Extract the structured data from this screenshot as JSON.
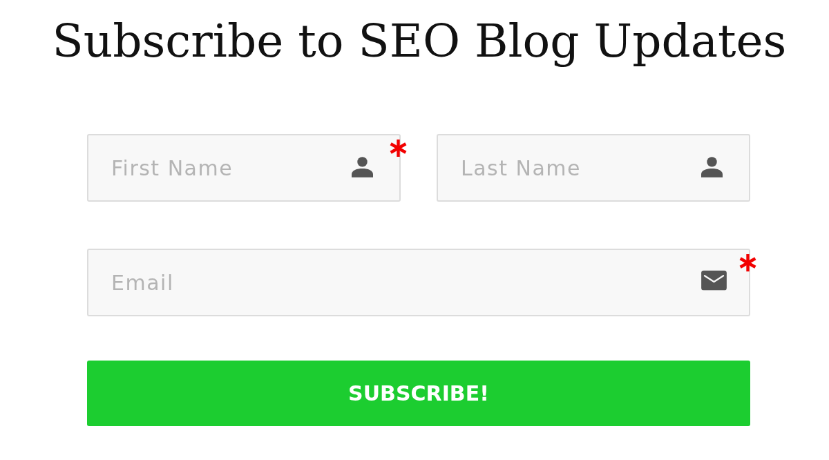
{
  "title": "Subscribe to SEO Blog Updates",
  "rows": [
    {
      "fields": [
        {
          "kind": "name",
          "placeholder": "First Name",
          "required": true
        },
        {
          "kind": "name",
          "placeholder": "Last Name",
          "required": false
        }
      ]
    },
    {
      "fields": [
        {
          "kind": "email",
          "placeholder": "Email",
          "required": true
        }
      ]
    }
  ],
  "button": "SUBSCRIBE!"
}
